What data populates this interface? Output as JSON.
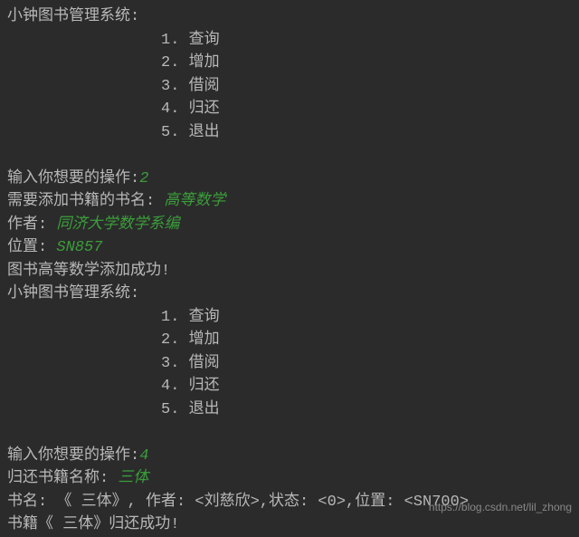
{
  "menu1": {
    "title": "小钟图书管理系统:",
    "items": [
      "1. 查询",
      "2. 增加",
      "3. 借阅",
      "4. 归还",
      "5. 退出"
    ]
  },
  "blank": " ",
  "session1": {
    "prompt_op": "输入你想要的操作:",
    "input_op": "2",
    "prompt_name": "需要添加书籍的书名: ",
    "input_name": "高等数学",
    "prompt_author": "作者: ",
    "input_author": "同济大学数学系编",
    "prompt_pos": "位置: ",
    "input_pos": "SN857",
    "success": "图书高等数学添加成功!"
  },
  "menu2": {
    "title": "小钟图书管理系统:",
    "items": [
      "1. 查询",
      "2. 增加",
      "3. 借阅",
      "4. 归还",
      "5. 退出"
    ]
  },
  "session2": {
    "prompt_op": "输入你想要的操作:",
    "input_op": "4",
    "prompt_return": "归还书籍名称: ",
    "input_return": "三体",
    "info": "书名: 《 三体》, 作者: <刘慈欣>,状态: <0>,位置: <SN700>",
    "success": "书籍《 三体》归还成功!"
  },
  "watermark": "https://blog.csdn.net/lil_zhong"
}
